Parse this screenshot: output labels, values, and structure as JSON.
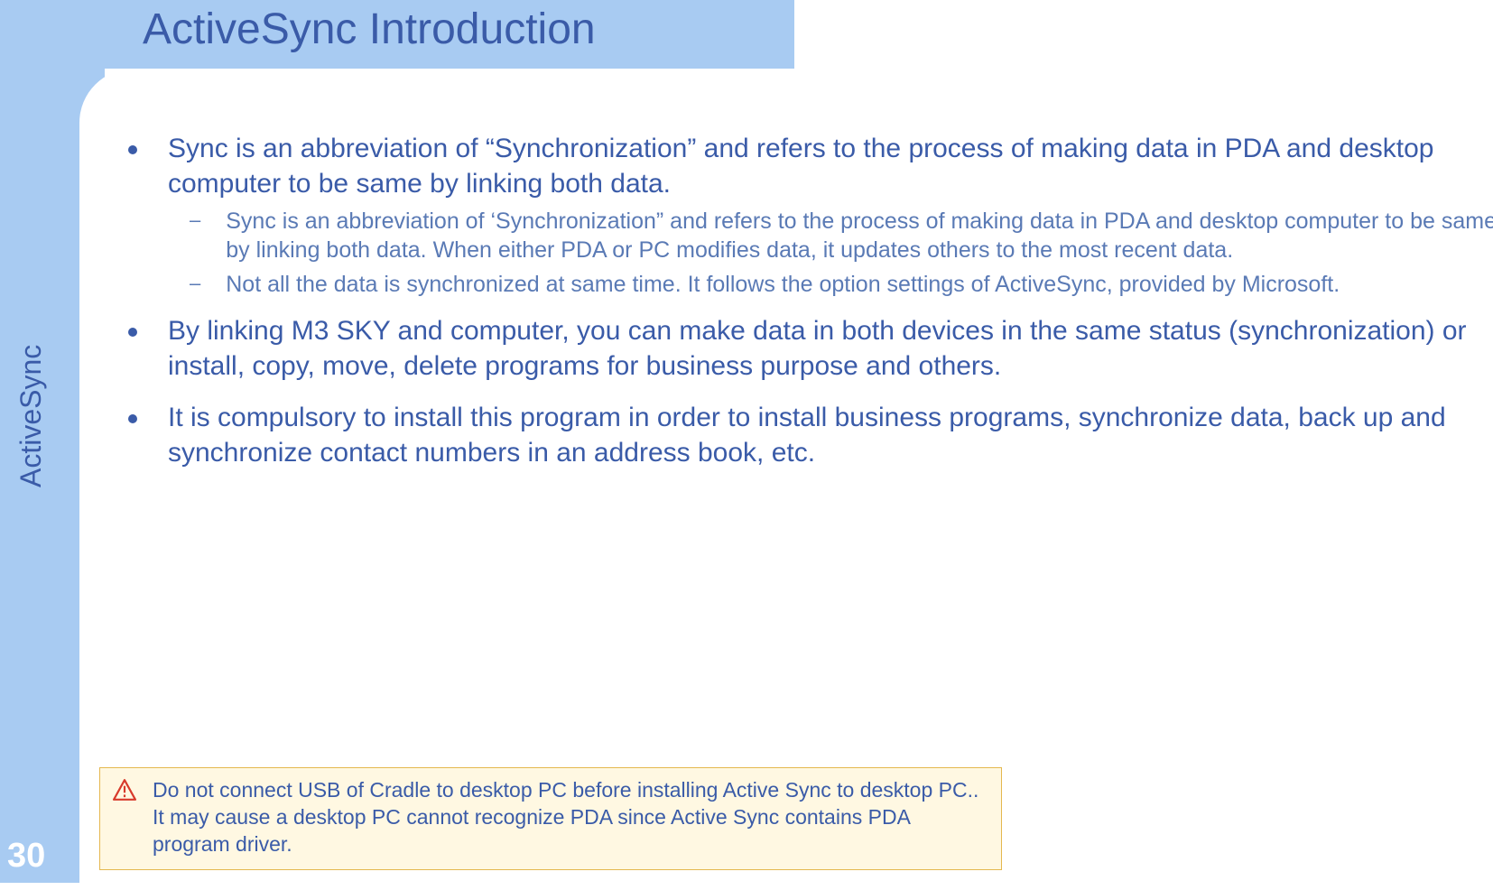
{
  "title": "ActiveSync Introduction",
  "side_label": "ActiveSync",
  "page_number": "30",
  "bullets": [
    {
      "text": "Sync is an abbreviation of “Synchronization” and refers to the process of making data in PDA and desktop computer to be same by linking both data.",
      "sub": [
        "Sync is an abbreviation of ‘Synchronization” and refers to the process of making data in PDA and desktop computer to be same by linking both data. When either PDA or PC modifies data, it updates others to the most recent data.",
        "Not all the data is synchronized at same time. It follows the option settings of ActiveSync, provided by Microsoft."
      ]
    },
    {
      "text": "By linking M3 SKY and computer, you can make data in both devices in the same status (synchronization) or install, copy, move, delete programs for business purpose and others.",
      "sub": []
    },
    {
      "text": "It is compulsory to install this program in order to install business programs, synchronize data, back up and synchronize contact numbers in an address book, etc.",
      "sub": []
    }
  ],
  "warning": "Do not connect USB of Cradle to desktop PC before installing Active Sync to desktop PC.. It may cause a desktop PC cannot recognize PDA since Active Sync contains PDA program driver."
}
